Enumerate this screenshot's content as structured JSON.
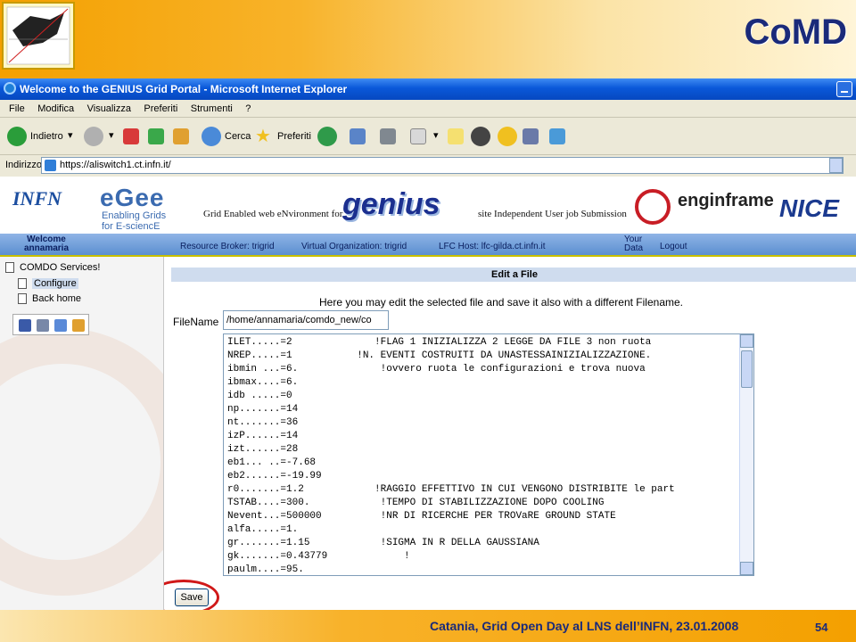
{
  "slide": {
    "title": "CoMD",
    "footer": "Catania, Grid Open Day al LNS dell’INFN, 23.01.2008",
    "page_number": "54",
    "brand_color": "#f4a000"
  },
  "window": {
    "title": "Welcome to the GENIUS Grid Portal - Microsoft Internet Explorer",
    "menu": [
      "File",
      "Modifica",
      "Visualizza",
      "Preferiti",
      "Strumenti",
      "?"
    ],
    "toolbar": {
      "back_label": "Indietro",
      "search_label": "Cerca",
      "favorites_label": "Preferiti"
    },
    "address": {
      "label": "Indirizzo",
      "url": "https://aliswitch1.ct.infn.it/"
    }
  },
  "portal": {
    "banner": {
      "infn": "INFN",
      "egee": "eGee",
      "egee_sub_1": "Enabling Grids",
      "egee_sub_2": "for E-sciencE",
      "genius_full": "Grid Enabled web eNvironment for",
      "genius": "genius",
      "genius_sub": "site Independent User job Submission",
      "enginframe": "enginframe",
      "nice": "NICE"
    },
    "nav": {
      "welcome_1": "Welcome",
      "welcome_2": "annamaria",
      "resource_broker": "Resource Broker: trigrid",
      "vo": "Virtual Organization: trigrid",
      "lfc": "LFC Host: lfc-gilda.ct.infn.it",
      "your_data_1": "Your",
      "your_data_2": "Data",
      "logout": "Logout"
    },
    "sidebar": {
      "root": "COMDO Services!",
      "items": [
        "Configure",
        "Back home"
      ]
    },
    "edit": {
      "header": "Edit a File",
      "description": "Here you may edit the selected file and save it also with a different Filename.",
      "filename_label": "FileName",
      "filename_value": "/home/annamaria/comdo_new/co",
      "lines": [
        "ILET.....=2              !FLAG 1 INIZIALIZZA 2 LEGGE DA FILE 3 non ruota",
        "NREP.....=1           !N. EVENTI COSTRUITI DA UNASTESSAINIZIALIZZAZIONE.",
        "ibmin ...=6.              !ovvero ruota le configurazioni e trova nuova",
        "ibmax....=6.",
        "idb .....=0",
        "np.......=14",
        "nt.......=36",
        "izP......=14",
        "izt......=28",
        "eb1... ..=-7.68",
        "eb2......=-19.99",
        "r0.......=1.2            !RAGGIO EFFETTIVO IN CUI VENGONO DISTRIBITE le part",
        "TSTAB....=300.            !TEMPO DI STABILIZZAZIONE DOPO COOLING",
        "Nevent...=500000          !NR DI RICERCHE PER TROVaRE GROUND STATE",
        "alfa.....=1.",
        "gr.......=1.15            !SIGMA IN R DELLA GAUSSIANA",
        "gk.......=0.43779             !",
        "paulm....=95."
      ],
      "save_label": "Save"
    }
  }
}
